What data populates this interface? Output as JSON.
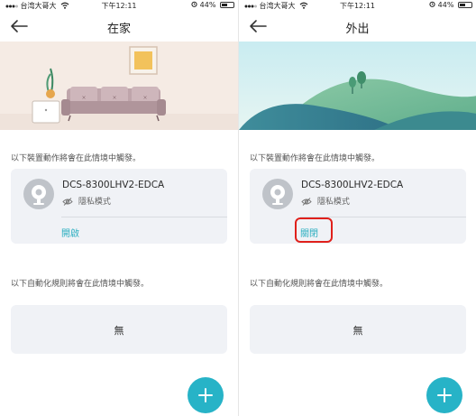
{
  "status_bar": {
    "carrier": "台湾大哥大",
    "time": "下午12:11",
    "battery": "44%"
  },
  "panels": [
    {
      "title": "在家",
      "devices_section_label": "以下裝置動作將會在此情境中觸發。",
      "device": {
        "name": "DCS-8300LHV2-EDCA",
        "mode": "隱私模式",
        "action": "開啟"
      },
      "automation_section_label": "以下自動化規則將會在此情境中觸發。",
      "automation_empty": "無",
      "hero_scene": "living-room"
    },
    {
      "title": "外出",
      "devices_section_label": "以下裝置動作將會在此情境中觸發。",
      "device": {
        "name": "DCS-8300LHV2-EDCA",
        "mode": "隱私模式",
        "action": "關閉"
      },
      "automation_section_label": "以下自動化規則將會在此情境中觸發。",
      "automation_empty": "無",
      "hero_scene": "hills"
    }
  ],
  "icons": {
    "back": "back-arrow-icon",
    "camera": "camera-icon",
    "privacy": "eye-slash-icon",
    "add": "plus-icon"
  },
  "colors": {
    "accent": "#27b3c7",
    "action_text": "#2aaec0",
    "highlight": "#e0201b",
    "card_bg": "#f0f2f6"
  }
}
